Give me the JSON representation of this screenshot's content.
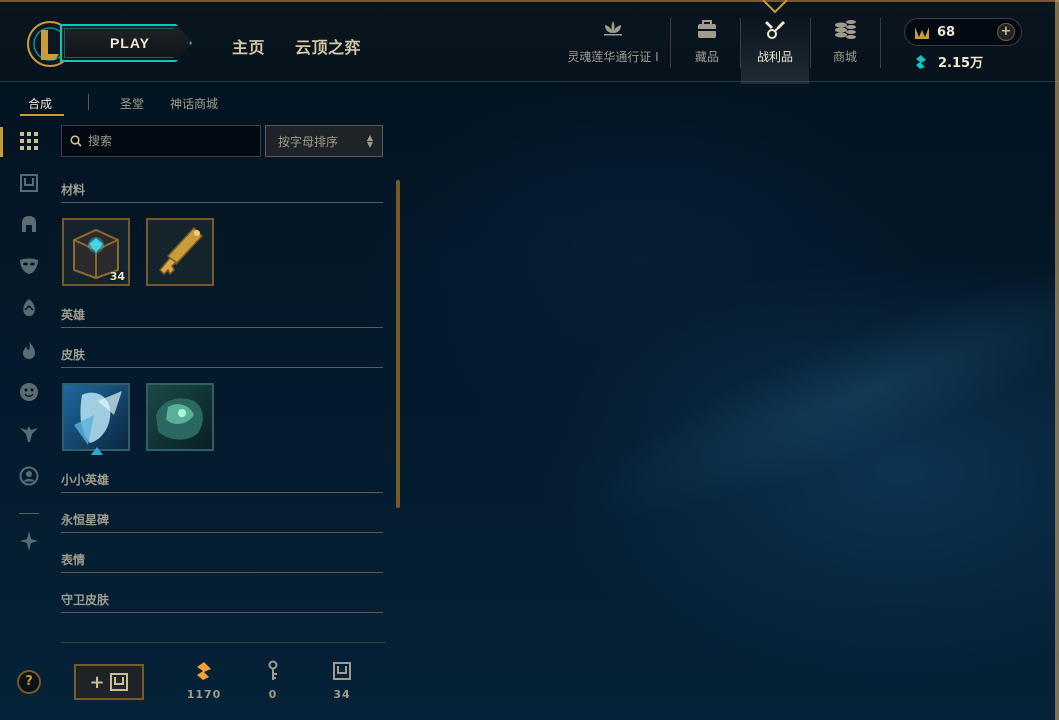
{
  "header": {
    "play_label": "PLAY",
    "nav": [
      "主页",
      "云顶之弈"
    ],
    "items": [
      {
        "label": "灵魂莲华通行证 I",
        "icon": "lotus-icon"
      },
      {
        "label": "藏品",
        "icon": "collection-bag-icon"
      },
      {
        "label": "战利品",
        "icon": "loot-icon",
        "active": true
      },
      {
        "label": "商城",
        "icon": "store-coins-icon"
      }
    ],
    "rp": "68",
    "essence": "2.15万"
  },
  "subnav": {
    "tabs": [
      "合成",
      "圣堂",
      "神话商城"
    ],
    "active": "合成"
  },
  "toolbar": {
    "search_placeholder": "搜索",
    "sort_label": "按字母排序"
  },
  "categories": {
    "materials": "材料",
    "champions": "英雄",
    "skins": "皮肤",
    "tacticians": "小小英雄",
    "eternals": "永恒星碑",
    "emotes": "表情",
    "ward_skins": "守卫皮肤"
  },
  "materials": [
    {
      "name": "hextech-chest",
      "count": "34"
    },
    {
      "name": "hextech-key",
      "count": ""
    }
  ],
  "footer": {
    "help": "?",
    "orange_essence": "1170",
    "keys": "0",
    "chests": "34"
  },
  "colors": {
    "gold": "#c89b3c",
    "teal": "#0ac8b9",
    "text": "#a09b8c",
    "orange": "#f0a030"
  }
}
